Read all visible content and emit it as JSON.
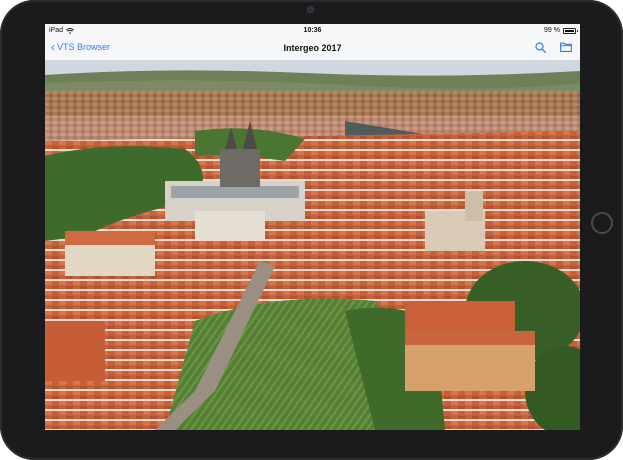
{
  "status_bar": {
    "device": "iPad",
    "time": "10:36",
    "battery": "99 %",
    "battery_level": 0.99
  },
  "nav": {
    "back_label": "VTS Browser",
    "title": "Intergeo 2017",
    "search_icon": "search-icon",
    "folder_icon": "folder-icon"
  },
  "colors": {
    "accent": "#2d7cf6",
    "bezel": "#1b1b1d",
    "roof": "#c8623c",
    "vegetation": "#3e6b2e",
    "sky": "#c9d6e0"
  },
  "map": {
    "content": "3D aerial city view with red-roofed buildings, castle and vineyards"
  }
}
